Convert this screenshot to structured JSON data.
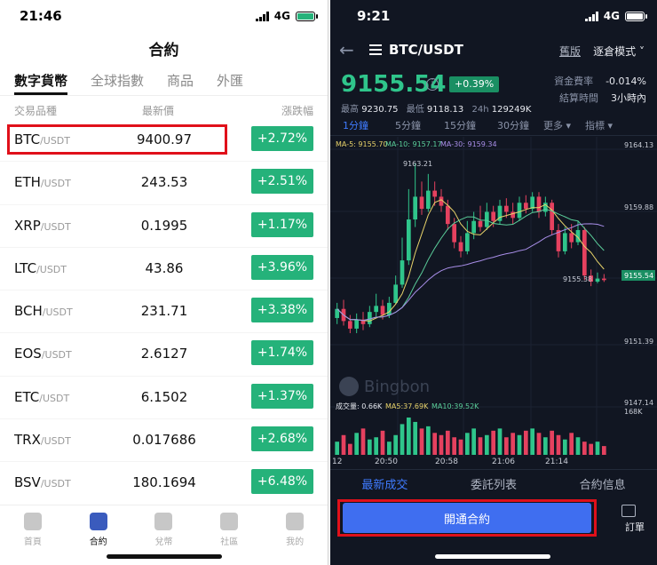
{
  "left": {
    "status": {
      "time": "21:46",
      "network": "4G"
    },
    "title": "合約",
    "tabs": [
      "數字貨幣",
      "全球指數",
      "商品",
      "外匯"
    ],
    "columns": {
      "symbol": "交易品種",
      "price": "最新價",
      "change": "漲跌幅"
    },
    "rows": [
      {
        "symbol": "BTC",
        "quote": "/USDT",
        "price": "9400.97",
        "change": "+2.72%"
      },
      {
        "symbol": "ETH",
        "quote": "/USDT",
        "price": "243.53",
        "change": "+2.51%"
      },
      {
        "symbol": "XRP",
        "quote": "/USDT",
        "price": "0.1995",
        "change": "+1.17%"
      },
      {
        "symbol": "LTC",
        "quote": "/USDT",
        "price": "43.86",
        "change": "+3.96%"
      },
      {
        "symbol": "BCH",
        "quote": "/USDT",
        "price": "231.71",
        "change": "+3.38%"
      },
      {
        "symbol": "EOS",
        "quote": "/USDT",
        "price": "2.6127",
        "change": "+1.74%"
      },
      {
        "symbol": "ETC",
        "quote": "/USDT",
        "price": "6.1502",
        "change": "+1.37%"
      },
      {
        "symbol": "TRX",
        "quote": "/USDT",
        "price": "0.017686",
        "change": "+2.68%"
      },
      {
        "symbol": "BSV",
        "quote": "/USDT",
        "price": "180.1694",
        "change": "+6.48%"
      }
    ],
    "nav": [
      "首頁",
      "合約",
      "兌幣",
      "社區",
      "我的"
    ],
    "colors": {
      "up": "#25b27a",
      "highlight": "#e0101a"
    }
  },
  "right": {
    "status": {
      "time": "9:21",
      "network": "4G"
    },
    "header": {
      "pair": "BTC/USDT",
      "version_label": "舊版",
      "mode_label": "逐倉模式"
    },
    "ticker": {
      "price": "9155.54",
      "change_pct": "+0.39%",
      "high_label": "最高",
      "high": "9230.75",
      "low_label": "最低",
      "low": "9118.13",
      "vol_label": "24h",
      "vol": "129249K",
      "funding_label": "資金費率",
      "funding_rate": "-0.014%",
      "settle_label": "結算時間",
      "settle_time": "3小時內"
    },
    "intervals": [
      "1分鐘",
      "5分鐘",
      "15分鐘",
      "30分鐘",
      "更多 ▾",
      "指標 ▾"
    ],
    "indicators": {
      "ma5": "MA-5: 9155.70",
      "ma10": "MA-10: 9157.17",
      "ma30": "MA-30: 9159.34",
      "vol_title": "成交量: 0.66K",
      "vol_ma5": "MA5:37.69K",
      "vol_ma10": "MA10:39.52K"
    },
    "axis_labels": [
      "9164.13",
      "9159.88",
      "9155.54",
      "9151.39",
      "9147.14",
      "168K"
    ],
    "time_labels": [
      "12",
      "20:50",
      "20:58",
      "21:06",
      "21:14"
    ],
    "annotations": {
      "peak": "9163.21",
      "trough": "9155.38"
    },
    "watermark": "Bingbon",
    "bottom_tabs": [
      "最新成交",
      "委託列表",
      "合約信息"
    ],
    "open_button": "開通合約",
    "order_label": "訂單",
    "colors": {
      "up": "#2fc58b",
      "down": "#e5415f",
      "accent": "#3f7bff",
      "ma5": "#e8d36a",
      "ma10": "#5bcf9b",
      "ma30": "#a88ee8"
    }
  },
  "chart_data": {
    "type": "candlestick",
    "y_range": [
      9147.14,
      9164.13
    ],
    "candles": [
      {
        "o": 9153.0,
        "c": 9153.6,
        "h": 9154.0,
        "l": 9152.6
      },
      {
        "o": 9153.6,
        "c": 9152.8,
        "h": 9154.2,
        "l": 9152.5
      },
      {
        "o": 9152.8,
        "c": 9152.3,
        "h": 9153.2,
        "l": 9152.0
      },
      {
        "o": 9152.3,
        "c": 9152.9,
        "h": 9153.3,
        "l": 9152.0
      },
      {
        "o": 9152.9,
        "c": 9152.6,
        "h": 9153.4,
        "l": 9152.2
      },
      {
        "o": 9152.6,
        "c": 9153.4,
        "h": 9153.8,
        "l": 9152.4
      },
      {
        "o": 9153.4,
        "c": 9153.8,
        "h": 9154.6,
        "l": 9153.1
      },
      {
        "o": 9153.8,
        "c": 9153.2,
        "h": 9154.2,
        "l": 9152.9
      },
      {
        "o": 9153.2,
        "c": 9154.0,
        "h": 9154.4,
        "l": 9153.0
      },
      {
        "o": 9154.0,
        "c": 9155.2,
        "h": 9155.8,
        "l": 9153.9
      },
      {
        "o": 9155.2,
        "c": 9156.8,
        "h": 9158.3,
        "l": 9155.0
      },
      {
        "o": 9156.8,
        "c": 9159.5,
        "h": 9161.5,
        "l": 9156.5
      },
      {
        "o": 9159.5,
        "c": 9161.0,
        "h": 9163.2,
        "l": 9159.0
      },
      {
        "o": 9161.0,
        "c": 9160.2,
        "h": 9162.0,
        "l": 9159.8
      },
      {
        "o": 9160.2,
        "c": 9161.4,
        "h": 9162.5,
        "l": 9160.0
      },
      {
        "o": 9161.4,
        "c": 9161.0,
        "h": 9162.0,
        "l": 9160.4
      },
      {
        "o": 9161.0,
        "c": 9160.4,
        "h": 9161.5,
        "l": 9160.0
      },
      {
        "o": 9160.4,
        "c": 9159.2,
        "h": 9160.8,
        "l": 9158.8
      },
      {
        "o": 9159.2,
        "c": 9158.0,
        "h": 9159.6,
        "l": 9157.6
      },
      {
        "o": 9158.0,
        "c": 9157.4,
        "h": 9158.4,
        "l": 9157.0
      },
      {
        "o": 9157.4,
        "c": 9158.6,
        "h": 9159.4,
        "l": 9157.2
      },
      {
        "o": 9158.6,
        "c": 9159.4,
        "h": 9160.0,
        "l": 9158.2
      },
      {
        "o": 9159.4,
        "c": 9159.0,
        "h": 9160.4,
        "l": 9158.7
      },
      {
        "o": 9159.0,
        "c": 9160.0,
        "h": 9160.6,
        "l": 9158.8
      },
      {
        "o": 9160.0,
        "c": 9159.4,
        "h": 9160.4,
        "l": 9159.0
      },
      {
        "o": 9159.4,
        "c": 9160.4,
        "h": 9160.8,
        "l": 9159.2
      },
      {
        "o": 9160.4,
        "c": 9160.0,
        "h": 9160.9,
        "l": 9159.6
      },
      {
        "o": 9160.0,
        "c": 9159.6,
        "h": 9160.6,
        "l": 9159.2
      },
      {
        "o": 9159.6,
        "c": 9160.6,
        "h": 9161.0,
        "l": 9159.4
      },
      {
        "o": 9160.6,
        "c": 9160.2,
        "h": 9161.1,
        "l": 9159.9
      },
      {
        "o": 9160.2,
        "c": 9161.0,
        "h": 9161.3,
        "l": 9160.0
      },
      {
        "o": 9161.0,
        "c": 9160.0,
        "h": 9161.3,
        "l": 9159.6
      },
      {
        "o": 9160.0,
        "c": 9160.6,
        "h": 9161.0,
        "l": 9159.7
      },
      {
        "o": 9160.6,
        "c": 9158.8,
        "h": 9160.8,
        "l": 9158.5
      },
      {
        "o": 9158.8,
        "c": 9157.4,
        "h": 9159.2,
        "l": 9157.0
      },
      {
        "o": 9157.4,
        "c": 9158.6,
        "h": 9159.0,
        "l": 9157.2
      },
      {
        "o": 9158.6,
        "c": 9158.0,
        "h": 9159.2,
        "l": 9157.6
      },
      {
        "o": 9158.0,
        "c": 9158.8,
        "h": 9159.4,
        "l": 9157.8
      },
      {
        "o": 9158.8,
        "c": 9155.8,
        "h": 9159.0,
        "l": 9155.5
      },
      {
        "o": 9155.8,
        "c": 9155.4,
        "h": 9156.2,
        "l": 9155.1
      },
      {
        "o": 9155.4,
        "c": 9155.6,
        "h": 9156.0,
        "l": 9155.3
      },
      {
        "o": 9155.6,
        "c": 9155.5,
        "h": 9155.9,
        "l": 9155.38
      }
    ],
    "volumes": [
      30,
      45,
      25,
      50,
      60,
      35,
      40,
      55,
      30,
      45,
      70,
      85,
      75,
      60,
      65,
      50,
      45,
      55,
      40,
      35,
      50,
      60,
      40,
      45,
      55,
      60,
      40,
      50,
      45,
      55,
      60,
      50,
      40,
      55,
      45,
      35,
      50,
      40,
      30,
      25,
      30,
      20
    ]
  }
}
